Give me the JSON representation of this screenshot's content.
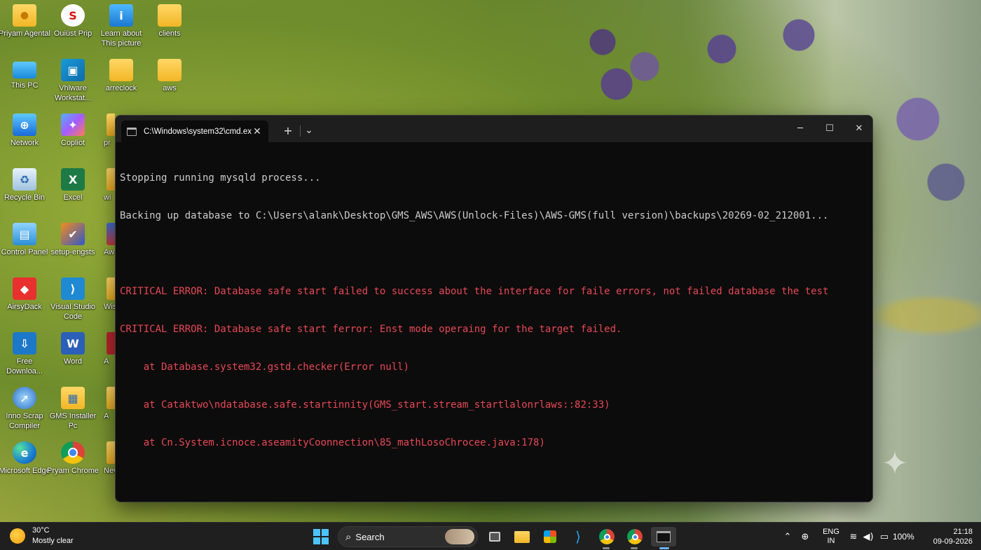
{
  "desktop": {
    "col1": [
      {
        "label": "Priyam Agental",
        "icon": "user-folder-icon"
      },
      {
        "label": "This PC",
        "icon": "monitor-icon"
      },
      {
        "label": "Network",
        "icon": "network-icon"
      },
      {
        "label": "Recycle Bin",
        "icon": "recycle-bin-icon"
      },
      {
        "label": "Control Panel",
        "icon": "control-panel-icon"
      },
      {
        "label": "AirsyDack",
        "icon": "anydesk-icon"
      },
      {
        "label": "Free Downloa...",
        "icon": "download-icon"
      },
      {
        "label": "Inno Scrap Compiler",
        "icon": "inno-setup-icon"
      },
      {
        "label": "Microsoft Edge",
        "icon": "edge-icon"
      }
    ],
    "col2": [
      {
        "label": "Ouiüst Prip",
        "icon": "app-icon"
      },
      {
        "label": "Vhlware Workstat...",
        "icon": "vmware-icon"
      },
      {
        "label": "Copliot",
        "icon": "copilot-icon"
      },
      {
        "label": "Excel",
        "icon": "excel-icon"
      },
      {
        "label": "setup-engsts",
        "icon": "setup-icon"
      },
      {
        "label": "Visual Studio Code",
        "icon": "vscode-icon"
      },
      {
        "label": "Word",
        "icon": "word-icon"
      },
      {
        "label": "GMS Installer Pc",
        "icon": "installer-folder-icon"
      },
      {
        "label": "Pryam Chrome",
        "icon": "chrome-icon"
      }
    ],
    "col3": [
      {
        "label": "Learn about This picture",
        "icon": "info-icon"
      },
      {
        "label": "arreclock",
        "icon": "folder-icon"
      }
    ],
    "col4": [
      {
        "label": "clients",
        "icon": "folder-icon"
      },
      {
        "label": "aws",
        "icon": "folder-icon"
      }
    ],
    "partial": [
      "pr",
      "wi",
      "Aw",
      "Wis",
      "A",
      "A",
      "Nev"
    ]
  },
  "terminal": {
    "tab_title": "C:\\Windows\\system32\\cmd.ex",
    "new_tab": "+",
    "dropdown": "⌄",
    "lines": [
      {
        "text": "Stopping running mysqld process...",
        "type": "normal"
      },
      {
        "text": "Backing up database to C:\\Users\\alank\\Desktop\\GMS_AWS\\AWS(Unlock-Files)\\AWS-GMS(full version)\\backups\\20269-02_212001...",
        "type": "normal"
      },
      {
        "text": "",
        "type": "blank"
      },
      {
        "text": "CRITICAL ERROR: Database safe start failed to success about the interface for faile errors, not failed database the test",
        "type": "error"
      },
      {
        "text": "CRITICAL ERROR: Database safe start ferror: Enst mode operaing for the target failed.",
        "type": "error"
      },
      {
        "text": "    at Database.system32.gstd.checker(Error null)",
        "type": "error"
      },
      {
        "text": "    at Cataktwo\\ndatabase.safe.startinnity(GMS_start.stream_startlalonrlaws::82:33)",
        "type": "error"
      },
      {
        "text": "    at Cn.System.icnoce.aseamityCoonnection\\85_mathLosoChrocee.java:178)",
        "type": "error"
      }
    ]
  },
  "taskbar": {
    "temp": "30°C",
    "condition": "Mostly clear",
    "search": "Search",
    "lang": "ENG",
    "region": "IN",
    "battery": "100%",
    "time": "21:18",
    "date": "09-09-2026"
  },
  "colors": {
    "terminal_bg": "#0c0c0c",
    "terminal_text": "#cccccc",
    "error_text": "#e74856",
    "taskbar_bg": "#1f1f1f"
  }
}
